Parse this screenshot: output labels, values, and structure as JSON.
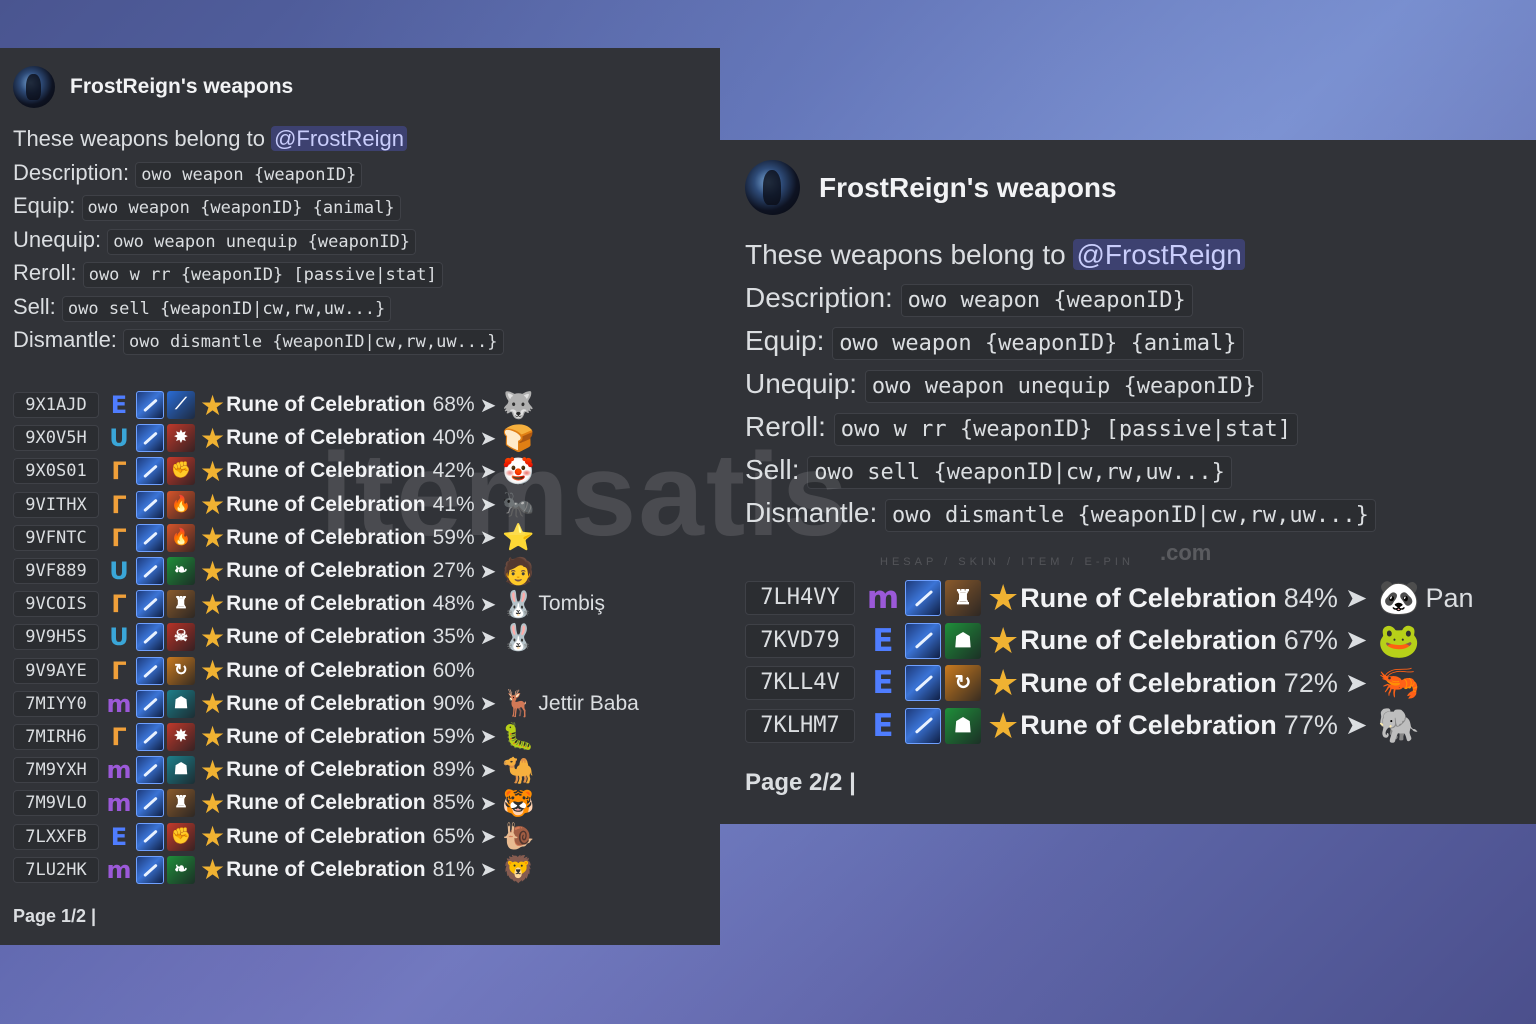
{
  "page1": {
    "title": "FrostReign's weapons",
    "intro_text": "These weapons belong to ",
    "mention": "@FrostReign",
    "commands": [
      {
        "label": "Description:",
        "code": "owo weapon {weaponID}"
      },
      {
        "label": "Equip:",
        "code": "owo weapon {weaponID} {animal}"
      },
      {
        "label": "Unequip:",
        "code": "owo weapon unequip {weaponID}"
      },
      {
        "label": "Reroll:",
        "code": "owo w rr {weaponID} [passive|stat]"
      },
      {
        "label": "Sell:",
        "code": "owo sell {weaponID|cw,rw,uw...}"
      },
      {
        "label": "Dismantle:",
        "code": "owo dismantle {weaponID|cw,rw,uw...}"
      }
    ],
    "weapons": [
      {
        "id": "9X1AJD",
        "tier": "E",
        "tier_color": "#4f7dff",
        "passive_icon": "blue-slash-icon",
        "passive_color": "#2a6cd6",
        "passive_glyph": "⟋",
        "star": "★",
        "name": "Rune of Celebration",
        "pct": "68%",
        "arrow": "➤",
        "animal": "🐺",
        "animal_name": ""
      },
      {
        "id": "9X0V5H",
        "tier": "U",
        "tier_color": "#3aa6d8",
        "passive_icon": "red-burst-icon",
        "passive_color": "#c0392b",
        "passive_glyph": "✸",
        "star": "★",
        "name": "Rune of Celebration",
        "pct": "40%",
        "arrow": "➤",
        "animal": "🍞",
        "animal_name": ""
      },
      {
        "id": "9X0S01",
        "tier": "Γ",
        "tier_color": "#f0a03a",
        "passive_icon": "red-fist-icon",
        "passive_color": "#c63a2b",
        "passive_glyph": "✊",
        "star": "★",
        "name": "Rune of Celebration",
        "pct": "42%",
        "arrow": "➤",
        "animal": "🤡",
        "animal_name": ""
      },
      {
        "id": "9VITHX",
        "tier": "Γ",
        "tier_color": "#f0a03a",
        "passive_icon": "flame-icon",
        "passive_color": "#d7542a",
        "passive_glyph": "🔥",
        "star": "★",
        "name": "Rune of Celebration",
        "pct": "41%",
        "arrow": "➤",
        "animal": "🐜",
        "animal_name": ""
      },
      {
        "id": "9VFNTC",
        "tier": "Γ",
        "tier_color": "#f0a03a",
        "passive_icon": "flame-icon",
        "passive_color": "#d7542a",
        "passive_glyph": "🔥",
        "star": "★",
        "name": "Rune of Celebration",
        "pct": "59%",
        "arrow": "➤",
        "animal": "⭐",
        "animal_name": ""
      },
      {
        "id": "9VF889",
        "tier": "U",
        "tier_color": "#3aa6d8",
        "passive_icon": "green-leaf-icon",
        "passive_color": "#1f8f3a",
        "passive_glyph": "❧",
        "star": "★",
        "name": "Rune of Celebration",
        "pct": "27%",
        "arrow": "➤",
        "animal": "🧑",
        "animal_name": ""
      },
      {
        "id": "9VCOIS",
        "tier": "Γ",
        "tier_color": "#f0a03a",
        "passive_icon": "brown-warrior-icon",
        "passive_color": "#8a5a2b",
        "passive_glyph": "♜",
        "star": "★",
        "name": "Rune of Celebration",
        "pct": "48%",
        "arrow": "➤",
        "animal": "🐰",
        "animal_name": "Tombiş"
      },
      {
        "id": "9V9H5S",
        "tier": "U",
        "tier_color": "#3aa6d8",
        "passive_icon": "red-roar-icon",
        "passive_color": "#b83227",
        "passive_glyph": "☠",
        "star": "★",
        "name": "Rune of Celebration",
        "pct": "35%",
        "arrow": "➤",
        "animal": "🐰",
        "animal_name": ""
      },
      {
        "id": "9V9AYE",
        "tier": "Γ",
        "tier_color": "#f0a03a",
        "passive_icon": "orange-swirl-icon",
        "passive_color": "#c97a1f",
        "passive_glyph": "↻",
        "star": "★",
        "name": "Rune of Celebration",
        "pct": "60%",
        "arrow": "",
        "animal": "",
        "animal_name": ""
      },
      {
        "id": "7MIYY0",
        "tier": "m",
        "tier_color": "#9b59d8",
        "passive_icon": "teal-figure-icon",
        "passive_color": "#1d7f8a",
        "passive_glyph": "☗",
        "star": "★",
        "name": "Rune of Celebration",
        "pct": "90%",
        "arrow": "➤",
        "animal": "🦌",
        "animal_name": "Jettir Baba"
      },
      {
        "id": "7MIRH6",
        "tier": "Γ",
        "tier_color": "#f0a03a",
        "passive_icon": "red-burst-icon",
        "passive_color": "#c0392b",
        "passive_glyph": "✸",
        "star": "★",
        "name": "Rune of Celebration",
        "pct": "59%",
        "arrow": "➤",
        "animal": "🐛",
        "animal_name": ""
      },
      {
        "id": "7M9YXH",
        "tier": "m",
        "tier_color": "#9b59d8",
        "passive_icon": "teal-figure-icon",
        "passive_color": "#1d7f8a",
        "passive_glyph": "☗",
        "star": "★",
        "name": "Rune of Celebration",
        "pct": "89%",
        "arrow": "➤",
        "animal": "🐪",
        "animal_name": ""
      },
      {
        "id": "7M9VLO",
        "tier": "m",
        "tier_color": "#9b59d8",
        "passive_icon": "brown-warrior-icon",
        "passive_color": "#8a5a2b",
        "passive_glyph": "♜",
        "star": "★",
        "name": "Rune of Celebration",
        "pct": "85%",
        "arrow": "➤",
        "animal": "🐯",
        "animal_name": ""
      },
      {
        "id": "7LXXFB",
        "tier": "E",
        "tier_color": "#4f7dff",
        "passive_icon": "red-fist-icon",
        "passive_color": "#c63a2b",
        "passive_glyph": "✊",
        "star": "★",
        "name": "Rune of Celebration",
        "pct": "65%",
        "arrow": "➤",
        "animal": "🐌",
        "animal_name": ""
      },
      {
        "id": "7LU2HK",
        "tier": "m",
        "tier_color": "#9b59d8",
        "passive_icon": "green-leaf-icon",
        "passive_color": "#1f8f3a",
        "passive_glyph": "❧",
        "star": "★",
        "name": "Rune of Celebration",
        "pct": "81%",
        "arrow": "➤",
        "animal": "🦁",
        "animal_name": ""
      }
    ],
    "footer": "Page 1/2 |"
  },
  "page2": {
    "title": "FrostReign's weapons",
    "intro_text": "These weapons belong to ",
    "mention": "@FrostReign",
    "commands": [
      {
        "label": "Description:",
        "code": "owo weapon {weaponID}"
      },
      {
        "label": "Equip:",
        "code": "owo weapon {weaponID} {animal}"
      },
      {
        "label": "Unequip:",
        "code": "owo weapon unequip {weaponID}"
      },
      {
        "label": "Reroll:",
        "code": "owo w rr {weaponID} [passive|stat]"
      },
      {
        "label": "Sell:",
        "code": "owo sell {weaponID|cw,rw,uw...}"
      },
      {
        "label": "Dismantle:",
        "code": "owo dismantle {weaponID|cw,rw,uw...}"
      }
    ],
    "weapons": [
      {
        "id": "7LH4VY",
        "tier": "m",
        "tier_color": "#9b59d8",
        "passive_icon": "brown-warrior-icon",
        "passive_color": "#8a5a2b",
        "passive_glyph": "♜",
        "star": "★",
        "name": "Rune of Celebration",
        "pct": "84%",
        "arrow": "➤",
        "animal": "🐼",
        "animal_name": "Pan"
      },
      {
        "id": "7KVD79",
        "tier": "E",
        "tier_color": "#4f7dff",
        "passive_icon": "green-figure-icon",
        "passive_color": "#1f8f3a",
        "passive_glyph": "☗",
        "star": "★",
        "name": "Rune of Celebration",
        "pct": "67%",
        "arrow": "➤",
        "animal": "🐸",
        "animal_name": ""
      },
      {
        "id": "7KLL4V",
        "tier": "E",
        "tier_color": "#4f7dff",
        "passive_icon": "orange-swirl-icon",
        "passive_color": "#c97a1f",
        "passive_glyph": "↻",
        "star": "★",
        "name": "Rune of Celebration",
        "pct": "72%",
        "arrow": "➤",
        "animal": "🦐",
        "animal_name": ""
      },
      {
        "id": "7KLHM7",
        "tier": "E",
        "tier_color": "#4f7dff",
        "passive_icon": "green-figure-icon",
        "passive_color": "#1f8f3a",
        "passive_glyph": "☗",
        "star": "★",
        "name": "Rune of Celebration",
        "pct": "77%",
        "arrow": "➤",
        "animal": "🐘",
        "animal_name": ""
      }
    ],
    "footer": "Page 2/2 |"
  },
  "watermark": {
    "main": "itemsatis",
    "sub": "HESAP / SKIN / ITEM / E-PIN",
    "com": ".com"
  },
  "icons": {
    "avatar": "avatar-icon",
    "weapon": "staff-weapon-icon",
    "star": "star-icon",
    "arrow": "arrow-right-icon"
  }
}
